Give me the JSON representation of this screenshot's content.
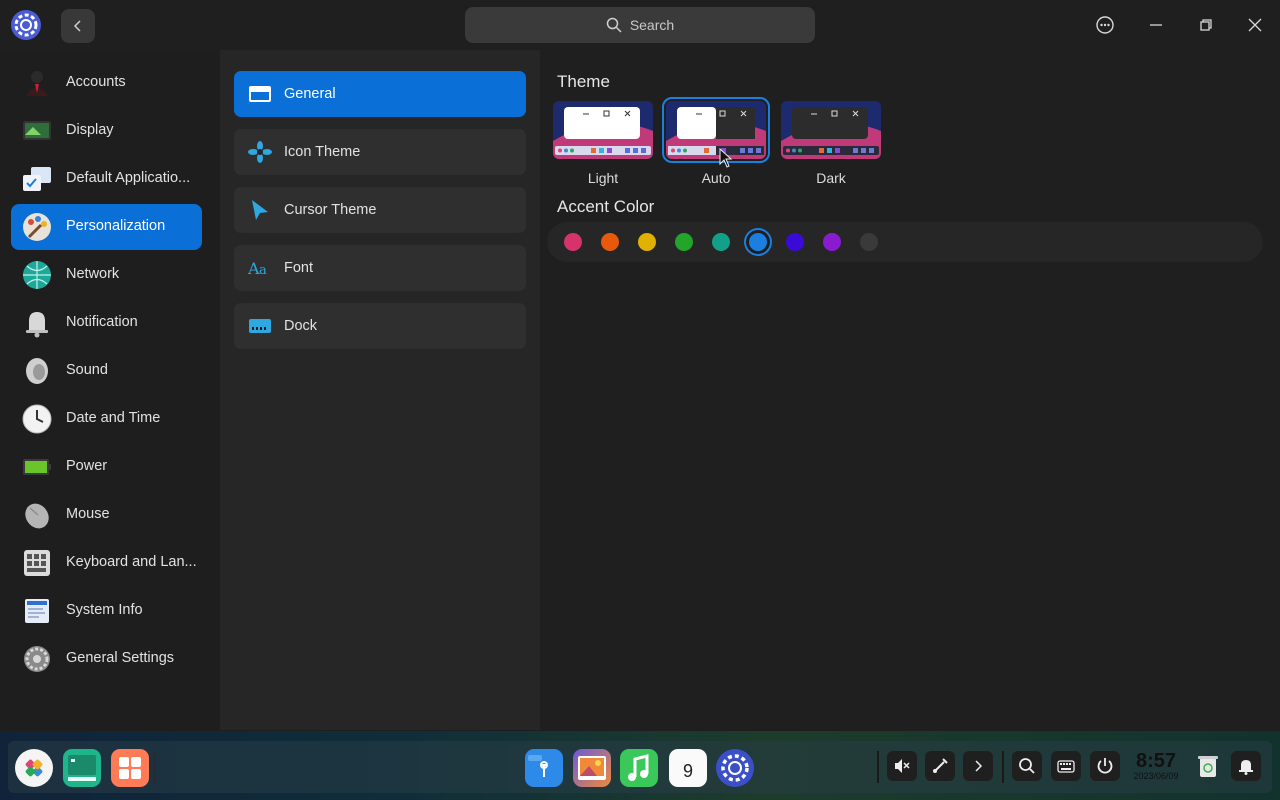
{
  "titlebar": {
    "search_label": "Search"
  },
  "sidebar": {
    "items": [
      {
        "label": "Accounts"
      },
      {
        "label": "Display"
      },
      {
        "label": "Default Applicatio..."
      },
      {
        "label": "Personalization"
      },
      {
        "label": "Network"
      },
      {
        "label": "Notification"
      },
      {
        "label": "Sound"
      },
      {
        "label": "Date and Time"
      },
      {
        "label": "Power"
      },
      {
        "label": "Mouse"
      },
      {
        "label": "Keyboard and Lan..."
      },
      {
        "label": "System Info"
      },
      {
        "label": "General Settings"
      }
    ],
    "active_index": 3
  },
  "midpanel": {
    "items": [
      {
        "label": "General"
      },
      {
        "label": "Icon Theme"
      },
      {
        "label": "Cursor Theme"
      },
      {
        "label": "Font"
      },
      {
        "label": "Dock"
      }
    ],
    "active_index": 0
  },
  "content": {
    "theme_title": "Theme",
    "themes": [
      {
        "label": "Light"
      },
      {
        "label": "Auto"
      },
      {
        "label": "Dark"
      }
    ],
    "selected_theme": "Auto",
    "accent_title": "Accent Color",
    "accent_colors": [
      "#d6336c",
      "#e8590c",
      "#e0b100",
      "#22a52a",
      "#12a089",
      "#1a7fe0",
      "#3a0bd8",
      "#8a1bd0",
      "#3a3a3a"
    ],
    "selected_accent_index": 5
  },
  "dock": {
    "clock_time": "8:57",
    "clock_date": "2023/06/09",
    "calendar_day": "9"
  },
  "colors": {
    "accent": "#0a6fd6"
  }
}
